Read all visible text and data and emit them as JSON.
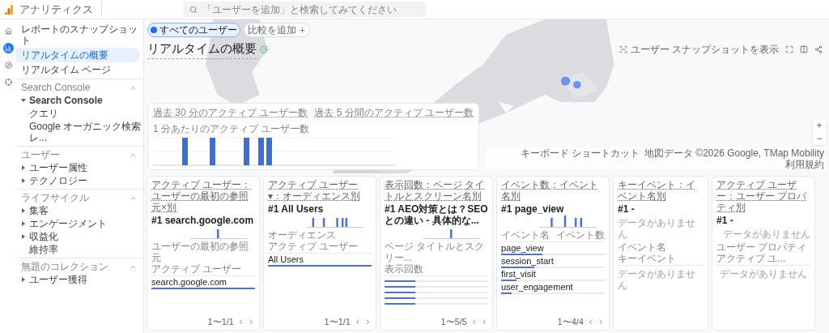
{
  "app": {
    "title": "アナリティクス",
    "search_placeholder": "「ユーザーを追加」と検索してみてください"
  },
  "rail": [
    {
      "kind": "home",
      "selected": false
    },
    {
      "kind": "reports",
      "selected": true
    },
    {
      "kind": "explore",
      "selected": false
    },
    {
      "kind": "advertising",
      "selected": false
    }
  ],
  "sidebar": {
    "top": [
      {
        "label": "レポートのスナップショット",
        "selected": false
      },
      {
        "label": "リアルタイムの概要",
        "selected": true
      },
      {
        "label": "リアルタイム ページ",
        "selected": false
      }
    ],
    "sections": [
      {
        "title": "Search Console",
        "expanded": true,
        "items": [
          {
            "kind": "folder",
            "label": "Search Console",
            "expanded": true,
            "children": [
              {
                "label": "クエリ"
              },
              {
                "label": "Google オーガニック検索レ..."
              }
            ]
          }
        ]
      },
      {
        "title": "ユーザー",
        "expanded": true,
        "items": [
          {
            "kind": "folder",
            "label": "ユーザー属性",
            "expanded": false
          },
          {
            "kind": "folder",
            "label": "テクノロジー",
            "expanded": false
          }
        ]
      },
      {
        "title": "ライフサイクル",
        "expanded": true,
        "items": [
          {
            "kind": "folder",
            "label": "集客",
            "expanded": false
          },
          {
            "kind": "folder",
            "label": "エンゲージメント",
            "expanded": false
          },
          {
            "kind": "folder",
            "label": "収益化",
            "expanded": false
          },
          {
            "kind": "page",
            "label": "維持率"
          }
        ]
      },
      {
        "title": "無題のコレクション",
        "expanded": true,
        "items": [
          {
            "kind": "folder",
            "label": "ユーザー獲得",
            "expanded": false
          }
        ]
      }
    ]
  },
  "header": {
    "chips": [
      {
        "kind": "segment",
        "label": "すべてのユーザー"
      },
      {
        "kind": "add",
        "label": "比較を追加"
      }
    ],
    "title": "リアルタイムの概要",
    "snapshot_button": "ユーザー スナップショットを表示"
  },
  "map": {
    "zoom_in": "+",
    "zoom_out": "−",
    "attribution": [
      "キーボード ショートカット",
      "地図データ ©2026 Google, TMap Mobility",
      "利用規約"
    ]
  },
  "realtime_card": {
    "metrics": [
      "過去 30 分のアクティブ ユーザー数",
      "過去 5 分間のアクティブ ユーザー数"
    ],
    "chart_label": "1 分あたりのアクティブ ユーザー数"
  },
  "cards": [
    {
      "kind": "table",
      "title": "アクティブ ユーザー：ユーザーの最初の参照元×別",
      "top": "#1 search.google.com",
      "columns": [
        "ユーザーの最初の参照元",
        "アクティブ ユーザー"
      ],
      "rows": [
        {
          "label": "search.google.com",
          "level": 1
        }
      ],
      "pager": "1〜1/1"
    },
    {
      "kind": "table",
      "title": "アクティブ ユーザー▾：オーディエンス別",
      "top": "#1 All Users",
      "columns": [
        "オーディエンス",
        "アクティブ ユーザー"
      ],
      "rows": [
        {
          "label": "All Users",
          "level": 1
        }
      ],
      "pager": "1〜1/1"
    },
    {
      "kind": "table",
      "title": "表示回数：ページ タイトルとスクリーン名別",
      "top": "#1 AEO対策とは？SEOとの違い - 具体的な...",
      "columns": [
        "ページ タイトルとスクリー...",
        "表示回数"
      ],
      "rows": [
        {
          "level": 0.3
        },
        {
          "level": 0.3
        },
        {
          "level": 0.3
        },
        {
          "level": 0.3
        },
        {
          "level": 0.3
        }
      ],
      "pager": "1〜5/5"
    },
    {
      "kind": "table",
      "title": "イベント数：イベント名別",
      "top": "#1 page_view",
      "columns": [
        "イベント名",
        "イベント数"
      ],
      "rows": [
        {
          "label": "page_view",
          "level": 0.4
        },
        {
          "label": "session_start",
          "level": 0.32
        },
        {
          "label": "first_visit",
          "level": 0.15
        },
        {
          "label": "user_engagement",
          "level": 0.1
        }
      ],
      "pager": "1〜4/4"
    },
    {
      "kind": "empty",
      "title": "キーイベント：イベント名別",
      "top": "#1 -",
      "chart_empty": "データがありません",
      "columns": [
        "イベント名",
        "キーイベント"
      ],
      "table_empty": "データがありません"
    },
    {
      "kind": "empty",
      "title": "アクティブ ユーザー：ユーザー プロパティ別",
      "top": "#1 -",
      "chart_empty": "データがありません",
      "columns": [
        "ユーザー プロパティ",
        "アクティブ ユ..."
      ],
      "table_empty": "データがありません"
    }
  ]
}
